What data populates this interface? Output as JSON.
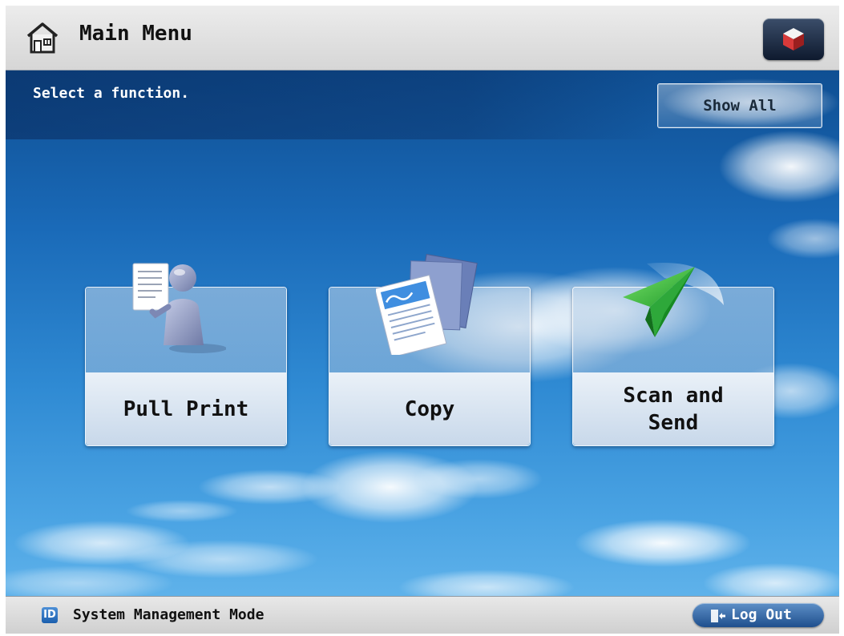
{
  "header": {
    "title": "Main Menu",
    "home_icon": "home-icon",
    "status_icon": "status-monitor-icon"
  },
  "main": {
    "instruction": "Select a function.",
    "show_all_label": "Show All",
    "tiles": [
      {
        "label": "Pull Print",
        "icon": "pull-print-icon"
      },
      {
        "label": "Copy",
        "icon": "copy-icon"
      },
      {
        "label": "Scan and\nSend",
        "icon": "paper-plane-icon"
      }
    ]
  },
  "footer": {
    "id_badge": "ID",
    "mode_text": "System Management Mode",
    "logout_label": "Log Out",
    "logout_icon": "logout-door-icon"
  },
  "colors": {
    "sky_top": "#0f4f93",
    "sky_bottom": "#5fb2ea",
    "logout_button": "#1f4f8d",
    "status_button": "#0e1a2e",
    "plane_green": "#3cc23c"
  }
}
